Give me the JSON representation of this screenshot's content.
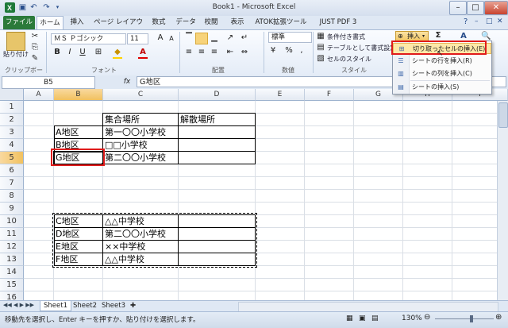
{
  "window": {
    "title": "Book1 - Microsoft Excel",
    "controls": [
      "–",
      "□",
      "✕"
    ]
  },
  "quick_access": [
    "save-icon",
    "undo-icon",
    "redo-icon"
  ],
  "tabs": [
    "ファイル",
    "ホーム",
    "挿入",
    "ページ レイアウト",
    "数式",
    "データ",
    "校閲",
    "表示",
    "ATOK拡張ツール",
    "JUST PDF 3"
  ],
  "ribbon": {
    "clipboard": {
      "paste_label": "貼り付け",
      "group_label": "クリップボード"
    },
    "font": {
      "font_name": "ＭＳ Ｐゴシック",
      "font_size": "11",
      "bold": "B",
      "italic": "I",
      "underline": "U",
      "group_label": "フォント"
    },
    "alignment": {
      "group_label": "配置"
    },
    "number": {
      "format": "標準",
      "percent": "%",
      "comma": ",",
      "group_label": "数値"
    },
    "styles": {
      "conditional": "条件付き書式",
      "table": "テーブルとして書式設定",
      "cell_style": "セルのスタイル",
      "group_label": "スタイル"
    },
    "cells": {
      "insert_label": "挿入",
      "sigma": "Σ"
    }
  },
  "formula_bar": {
    "name_box": "B5",
    "fx": "fx",
    "content": "G地区"
  },
  "columns": [
    "A",
    "B",
    "C",
    "D",
    "E",
    "F",
    "G",
    "H",
    "I"
  ],
  "rows": [
    "1",
    "2",
    "3",
    "4",
    "5",
    "6",
    "7",
    "8",
    "9",
    "10",
    "11",
    "12",
    "13",
    "14",
    "15",
    "16"
  ],
  "cells": {
    "c2": "集合場所",
    "d2": "解散場所",
    "b3": "A地区",
    "c3": "第一〇〇小学校",
    "b4": "B地区",
    "c4": "□□小学校",
    "b5": "G地区",
    "c5": "第二〇〇小学校",
    "b10": "C地区",
    "c10": "△△中学校",
    "b11": "D地区",
    "c11": "第二〇〇小学校",
    "b12": "E地区",
    "c12": "××中学校",
    "b13": "F地区",
    "c13": "△△中学校"
  },
  "menu": {
    "items": [
      "切り取ったセルの挿入(E)",
      "シートの行を挿入(R)",
      "シートの列を挿入(C)",
      "シートの挿入(S)"
    ]
  },
  "sheets": [
    "Sheet1",
    "Sheet2",
    "Sheet3"
  ],
  "status": {
    "message": "移動先を選択し、Enter キーを押すか、貼り付けを選択します。",
    "zoom": "130%"
  }
}
